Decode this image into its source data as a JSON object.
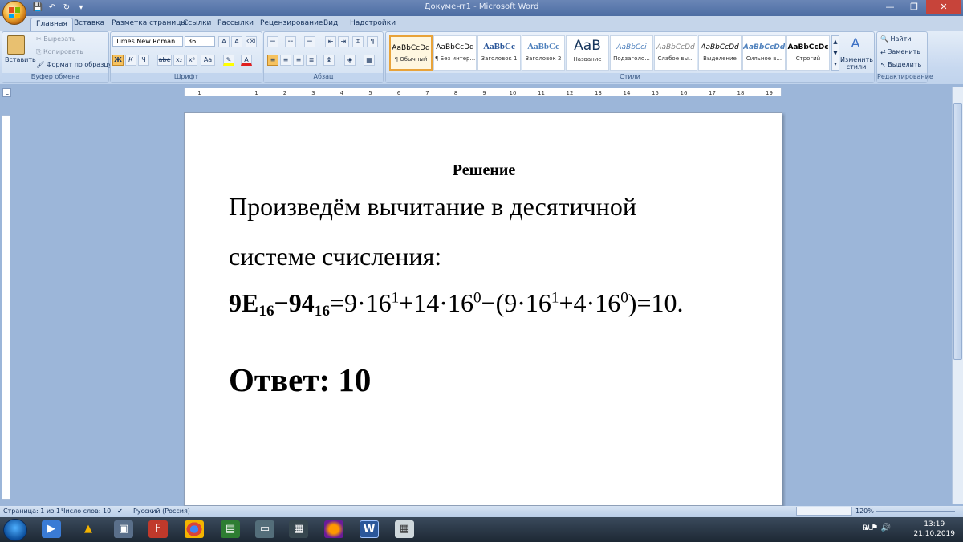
{
  "window": {
    "title": "Документ1 - Microsoft Word",
    "minimize": "—",
    "maximize": "❐",
    "close": "✕"
  },
  "qat": [
    "💾",
    "↶",
    "↻",
    "▾"
  ],
  "tabs": [
    "Главная",
    "Вставка",
    "Разметка страницы",
    "Ссылки",
    "Рассылки",
    "Рецензирование",
    "Вид",
    "Надстройки"
  ],
  "clipboard": {
    "paste": "Вставить",
    "cut": "Вырезать",
    "copy": "Копировать",
    "format_painter": "Формат по образцу",
    "label": "Буфер обмена"
  },
  "font": {
    "name": "Times New Roman",
    "size": "36",
    "label": "Шрифт",
    "buttons": [
      "Ж",
      "К",
      "Ч",
      "abe",
      "x₂",
      "x²",
      "Aa"
    ]
  },
  "paragraph": {
    "label": "Абзац"
  },
  "styles": {
    "label": "Стили",
    "items": [
      {
        "sample": "AaBbCcDd",
        "name": "¶ Обычный"
      },
      {
        "sample": "AaBbCcDd",
        "name": "¶ Без интер..."
      },
      {
        "sample": "AaBbCc",
        "name": "Заголовок 1"
      },
      {
        "sample": "AaBbCc",
        "name": "Заголовок 2"
      },
      {
        "sample": "AaB",
        "name": "Название"
      },
      {
        "sample": "AaBbCci",
        "name": "Подзаголо..."
      },
      {
        "sample": "AaBbCcDd",
        "name": "Слабое вы..."
      },
      {
        "sample": "AaBbCcDd",
        "name": "Выделение"
      },
      {
        "sample": "AaBbCcDd",
        "name": "Сильное в..."
      },
      {
        "sample": "AaBbCcDc",
        "name": "Строгий"
      }
    ],
    "change": "Изменить стили"
  },
  "editing": {
    "label": "Редактирование",
    "find": "Найти",
    "replace": "Заменить",
    "select": "Выделить"
  },
  "document": {
    "heading": "Решение",
    "line1": "Произведём вычитание в десятичной",
    "line2": "системе счисления:",
    "formula": {
      "a": "9E",
      "a_base": "16",
      "minus": "−",
      "b": "94",
      "b_base": "16",
      "rest_1": "=9·16",
      "e1": "1",
      "rest_2": "+14·16",
      "e2": "0",
      "rest_3": "−(9·16",
      "e3": "1",
      "rest_4": "+4·16",
      "e4": "0",
      "rest_5": ")=10."
    },
    "answer": "Ответ: 10"
  },
  "status": {
    "page": "Страница: 1 из 1",
    "words": "Число слов: 10",
    "language": "Русский (Россия)",
    "zoom": "120%"
  },
  "taskbar": {
    "lang": "RU",
    "time": "13:19",
    "date": "21.10.2019"
  }
}
